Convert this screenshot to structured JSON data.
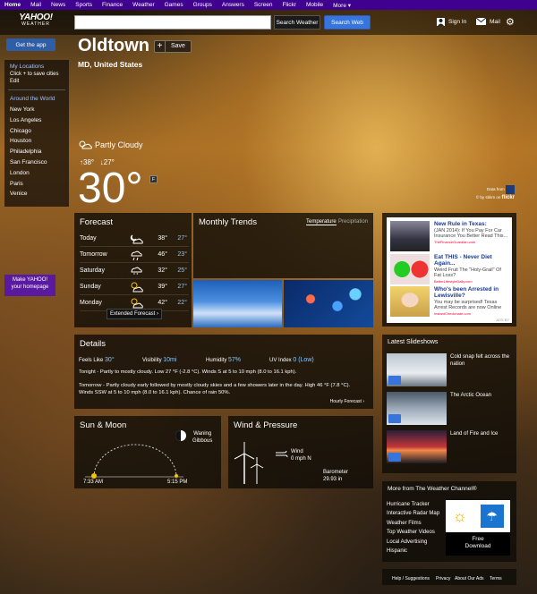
{
  "topnav": [
    "Home",
    "Mail",
    "News",
    "Sports",
    "Finance",
    "Weather",
    "Games",
    "Groups",
    "Answers",
    "Screen",
    "Flickr",
    "Mobile",
    "More ▾"
  ],
  "logo": {
    "line1": "YAHOO!",
    "line2": "WEATHER"
  },
  "search": {
    "placeholder": "",
    "weather_btn": "Search Weather",
    "web_btn": "Search Web"
  },
  "header_right": {
    "signin": "Sign In",
    "mail": "Mail"
  },
  "sidebar": {
    "get_app": "Get the app",
    "my_locations": "My Locations",
    "click_save": "Click + to save cities",
    "edit": "Edit",
    "around": "Around the World",
    "cities": [
      "New York",
      "Los Angeles",
      "Chicago",
      "Houston",
      "Philadelphia",
      "San Francisco",
      "London",
      "Paris",
      "Venice"
    ],
    "make_yahoo_1": "Make YAHOO!",
    "make_yahoo_2": "your homepage"
  },
  "location": {
    "city": "Oldtown",
    "region": "MD, United States",
    "save": "Save"
  },
  "current": {
    "condition": "Partly Cloudy",
    "hi": "38°",
    "lo": "27°",
    "temp": "30°",
    "unit": "F"
  },
  "credit": {
    "data_from": "Data from",
    "photo": "© by sbkm on"
  },
  "forecast": {
    "title": "Forecast",
    "days": [
      {
        "day": "Today",
        "hi": "38°",
        "lo": "27°",
        "icon": "partly-cloudy-night-icon"
      },
      {
        "day": "Tomorrow",
        "hi": "46°",
        "lo": "23°",
        "icon": "showers-icon"
      },
      {
        "day": "Saturday",
        "hi": "32°",
        "lo": "25°",
        "icon": "snow-icon"
      },
      {
        "day": "Sunday",
        "hi": "39°",
        "lo": "27°",
        "icon": "partly-cloudy-icon"
      },
      {
        "day": "Monday",
        "hi": "42°",
        "lo": "22°",
        "icon": "partly-cloudy-icon"
      }
    ],
    "extended": "Extended Forecast ›"
  },
  "trends": {
    "title": "Monthly Trends",
    "tab1": "Temperature",
    "tab2": "Precipitation"
  },
  "ads": [
    {
      "title": "New Rule in Texas:",
      "desc": "(JAN 2014): If You Pay For Car Insurance You Better Read This...",
      "link": "TheFinanceGuardian.com"
    },
    {
      "title": "Eat THIS - Never Diet Again...",
      "desc": "Weird Fruit The \"Holy-Grail\" Of Fat Loss?",
      "link": "BetterLifestyleDaily.com"
    },
    {
      "title": "Who's been Arrested in Lewisville?",
      "desc": "You may be surprised! Texas Arrest Records are now Online",
      "link": "InstantCheckmate.com"
    }
  ],
  "ads_by": "ADS BY",
  "details": {
    "title": "Details",
    "feels_label": "Feels Like",
    "feels": "30°",
    "vis_label": "Visibility",
    "vis": "10mi",
    "hum_label": "Humidity",
    "hum": "57%",
    "uv_label": "UV Index",
    "uv": "0 (Low)",
    "tonight": "Tonight - Partly to mostly cloudy. Low 27 °F (-2.8 °C). Winds S at 5 to 10 mph (8.0 to 16.1 kph).",
    "tomorrow": "Tomorrow - Partly cloudy early followed by mostly cloudy skies and a few showers later in the day. High 46 °F (7.8 °C). Winds SSW at 5 to 10 mph (8.0 to 16.1 kph). Chance of rain 50%.",
    "hourly": "Hourly Forecast ›"
  },
  "slideshows": {
    "title": "Latest Slideshows",
    "items": [
      "Cold snap felt across the nation",
      "The Arctic Ocean",
      "Land of Fire and Ice"
    ]
  },
  "sunmoon": {
    "title": "Sun & Moon",
    "moon1": "Waning",
    "moon2": "Gibbous",
    "sunrise": "7:33 AM",
    "sunset": "5:15 PM"
  },
  "wind": {
    "title": "Wind & Pressure",
    "wind_label": "Wind",
    "wind_val": "0 mph N",
    "baro_label": "Barometer",
    "baro_val": "29.93 in"
  },
  "twc": {
    "title": "More from The Weather Channel®",
    "links": [
      "Hurricane Tracker",
      "Interactive Radar Map",
      "Weather Films",
      "Top Weather Videos",
      "Local Advertising",
      "Hispanic"
    ],
    "free": "Free",
    "download": "Download"
  },
  "footer": [
    "Help / Suggestions",
    "Privacy",
    "About Our Ads",
    "Terms"
  ]
}
